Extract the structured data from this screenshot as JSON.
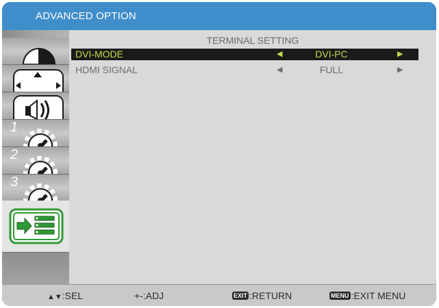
{
  "window": {
    "title": "ADVANCED OPTION"
  },
  "sidebar": {
    "items": [
      {
        "icon": "picture-icon"
      },
      {
        "icon": "screen-position-icon"
      },
      {
        "icon": "audio-speaker-icon"
      },
      {
        "icon": "gear-icon",
        "number": "1"
      },
      {
        "icon": "gear-icon",
        "number": "2"
      },
      {
        "icon": "gear-icon",
        "number": "3"
      },
      {
        "icon": "advanced-option-list-icon",
        "selected": true
      }
    ]
  },
  "panel": {
    "section_title": "TERMINAL SETTING",
    "rows": [
      {
        "label": "DVI-MODE",
        "arrow_left": "◀",
        "value": "DVI-PC",
        "arrow_right": "▶",
        "selected": true
      },
      {
        "label": "HDMI SIGNAL",
        "arrow_left": "◀",
        "value": "FULL",
        "arrow_right": "▶",
        "selected": false
      }
    ]
  },
  "helpbar": {
    "sel_symbol": "▲▼",
    "sel_label": ":SEL",
    "adj_label": "+-:ADJ",
    "exit_key": "EXIT",
    "exit_label": ":RETURN",
    "menu_key": "MENU",
    "menu_label": ":EXIT MENU"
  },
  "colors": {
    "title_bar": "#3f8ecb",
    "selected_text": "#c7d84a",
    "selected_row_bg": "#1a1a1a",
    "icon_green": "#2f9a35"
  }
}
